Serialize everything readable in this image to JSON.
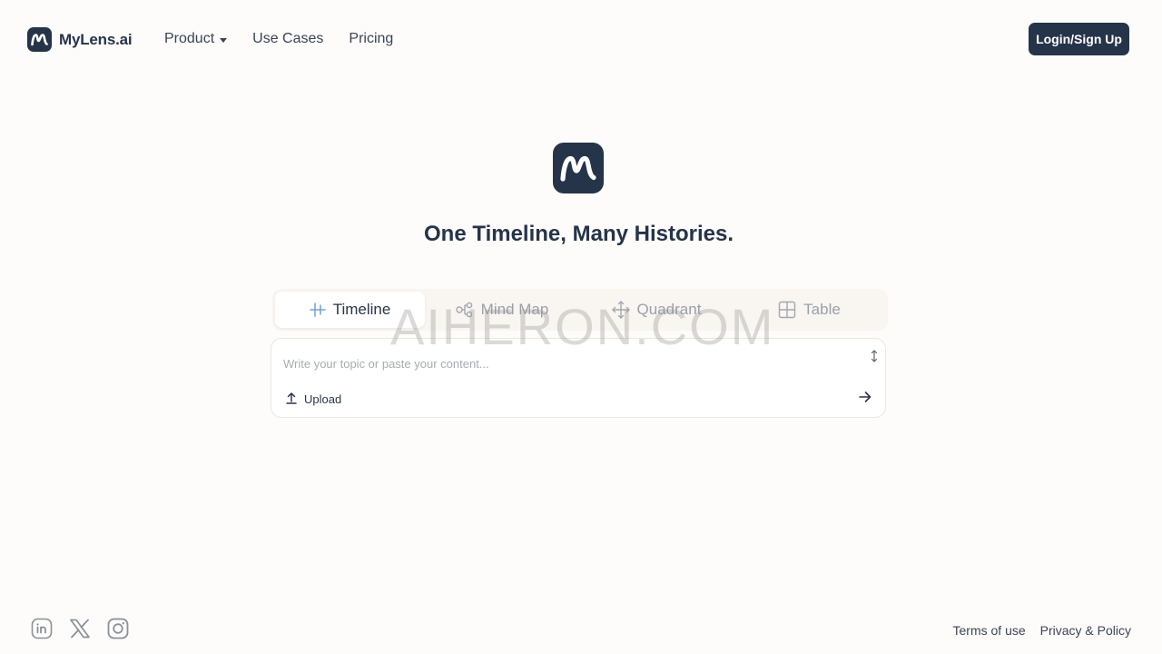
{
  "brand": {
    "name": "MyLens.ai",
    "logo_icon": "mylens-logo-icon",
    "color": "#26344a"
  },
  "nav": {
    "product": "Product",
    "use_cases": "Use Cases",
    "pricing": "Pricing"
  },
  "header": {
    "login_label": "Login/Sign Up"
  },
  "hero": {
    "tagline": "One Timeline, Many Histories."
  },
  "tabs": [
    {
      "label": "Timeline",
      "icon": "timeline-icon",
      "active": true
    },
    {
      "label": "Mind Map",
      "icon": "mind-map-icon",
      "active": false
    },
    {
      "label": "Quadrant",
      "icon": "quadrant-icon",
      "active": false
    },
    {
      "label": "Table",
      "icon": "table-icon",
      "active": false
    }
  ],
  "watermark": "AIHERON.COM",
  "composer": {
    "placeholder": "Write your topic or paste your content...",
    "value": "",
    "upload_label": "Upload"
  },
  "footer": {
    "socials": [
      "linkedin-icon",
      "x-icon",
      "instagram-icon"
    ],
    "terms": "Terms of use",
    "privacy": "Privacy & Policy"
  },
  "colors": {
    "background": "#fdfcfa",
    "primary": "#26344a",
    "muted_text": "#9aa0aa",
    "timeline_icon": "#6fa3d6"
  }
}
